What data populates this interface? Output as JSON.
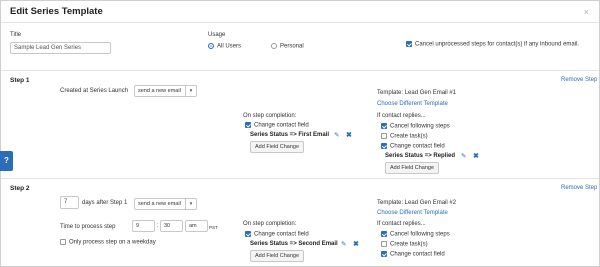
{
  "modal": {
    "title": "Edit Series Template"
  },
  "general": {
    "title_label": "Title",
    "title_value": "Sample Lead Gen Series",
    "usage_label": "Usage",
    "usage_all": "All Users",
    "usage_personal": "Personal",
    "cancel_unprocessed": "Cancel unprocessed steps for contact(s) if any inbound email."
  },
  "step1": {
    "title": "Step 1",
    "remove": "Remove Step",
    "created_label": "Created at Series Launch",
    "action": "send a new email",
    "template_label": "Template: Lead Gen Email #1",
    "choose_template": "Choose Different Template",
    "completion_label": "On step completion:",
    "change_contact_field": "Change contact field",
    "completion_field": "Series Status => First Email",
    "add_field_change": "Add Field Change",
    "if_replies": "If contact replies...",
    "cancel_following": "Cancel following steps",
    "create_tasks": "Create task(s)",
    "reply_change_field": "Change contact field",
    "reply_field": "Series Status => Replied",
    "reply_add_field_change": "Add Field Change"
  },
  "step2": {
    "title": "Step 2",
    "remove": "Remove Step",
    "days_value": "7",
    "days_label": "days after Step 1",
    "action": "send a new email",
    "template_label": "Template: Lead Gen Email #2",
    "choose_template": "Choose Different Template",
    "time_label": "Time to process step",
    "hour": "9",
    "minute": "30",
    "ampm": "am",
    "tz": "PST",
    "weekday_only": "Only process step on a weekday",
    "completion_label": "On step completion:",
    "change_contact_field": "Change contact field",
    "completion_field": "Series Status => Second Email",
    "add_field_change": "Add Field Change",
    "if_replies": "If contact replies...",
    "cancel_following": "Cancel following steps",
    "create_tasks": "Create task(s)",
    "reply_change_field": "Change contact field"
  },
  "help": {
    "label": "?"
  },
  "icons": {
    "close": "×",
    "pencil": "✎",
    "delete": "✖",
    "caret": "▼"
  },
  "colors": {
    "accent": "#2a6ebb",
    "help_tab": "#2a6ebb"
  }
}
